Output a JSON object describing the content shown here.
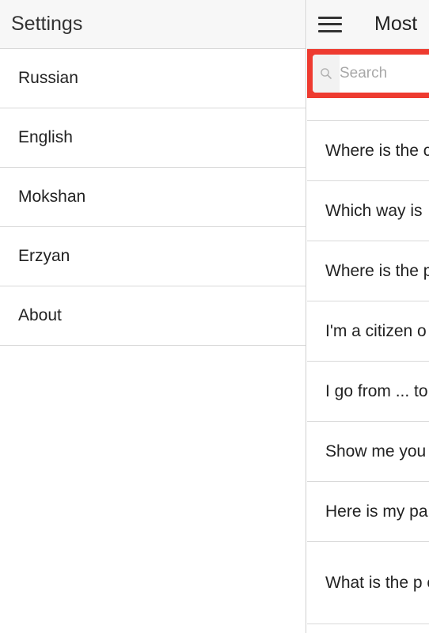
{
  "drawer": {
    "title": "Settings",
    "items": [
      {
        "label": "Russian"
      },
      {
        "label": "English"
      },
      {
        "label": "Mokshan"
      },
      {
        "label": "Erzyan"
      },
      {
        "label": "About"
      }
    ]
  },
  "main": {
    "menu_icon": "hamburger-menu-icon",
    "title": "Most",
    "search": {
      "placeholder": "Search",
      "value": "",
      "icon": "search-icon",
      "accent_color": "#ee3b30"
    },
    "phrases": [
      {
        "text": "Where is the c"
      },
      {
        "text": "Which way is"
      },
      {
        "text": "Where is the p"
      },
      {
        "text": "I'm a citizen o"
      },
      {
        "text": "I go from ... to"
      },
      {
        "text": "Show me you"
      },
      {
        "text": "Here is my pa"
      },
      {
        "text": "What is the p country?"
      }
    ]
  }
}
